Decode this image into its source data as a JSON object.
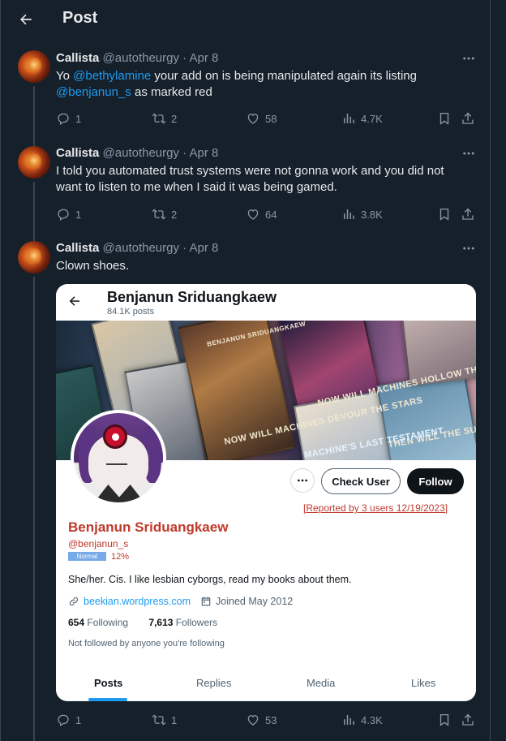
{
  "header": {
    "title": "Post"
  },
  "tweets": [
    {
      "name": "Callista",
      "handle": "@autotheurgy",
      "sep": "·",
      "date": "Apr 8",
      "text_parts": [
        "Yo ",
        "@bethylamine",
        " your add on is being manipulated again its listing",
        "@benjanun_s",
        " as marked red"
      ],
      "replies": "1",
      "reposts": "2",
      "likes": "58",
      "views": "4.7K"
    },
    {
      "name": "Callista",
      "handle": "@autotheurgy",
      "sep": "·",
      "date": "Apr 8",
      "text_line1": "I told you automated trust systems were not gonna work and you did not",
      "text_line2": "want to listen to me when I said it was being gamed.",
      "replies": "1",
      "reposts": "2",
      "likes": "64",
      "views": "3.8K"
    },
    {
      "name": "Callista",
      "handle": "@autotheurgy",
      "sep": "·",
      "date": "Apr 8",
      "text": "Clown shoes.",
      "replies": "1",
      "reposts": "1",
      "likes": "53",
      "views": "4.3K"
    }
  ],
  "card": {
    "name": "Benjanun Sriduangkaew",
    "posts": "84.1K posts",
    "banner_text": [
      "NOW WILL MACHINES DEVOUR THE STARS",
      "NOW WILL MACHINES HOLLOW THE BEAST",
      "THEN WILL THE SUN RISE ALABASTER",
      "MACHINE'S LAST TESTAMENT",
      "BENJANUN SRIDUANGKAEW"
    ],
    "check_user": "Check User",
    "follow": "Follow",
    "reported": "[Reported by 3 users 12/19/2023]",
    "display_name": "Benjanun Sriduangkaew",
    "handle": "@benjanun_s",
    "badge": "Normal",
    "percent": "12%",
    "bio": "She/her. Cis. I like lesbian cyborgs, read my books about them.",
    "website": "beekian.wordpress.com",
    "joined": "Joined May 2012",
    "following_count": "654",
    "following_label": "Following",
    "followers_count": "7,613",
    "followers_label": "Followers",
    "not_followed": "Not followed by anyone you're following",
    "tabs": [
      "Posts",
      "Replies",
      "Media",
      "Likes"
    ]
  },
  "colors": {
    "background": "#15202b",
    "accent": "#1d9bf0",
    "warning": "#c0392b",
    "muted": "#8b98a5"
  }
}
